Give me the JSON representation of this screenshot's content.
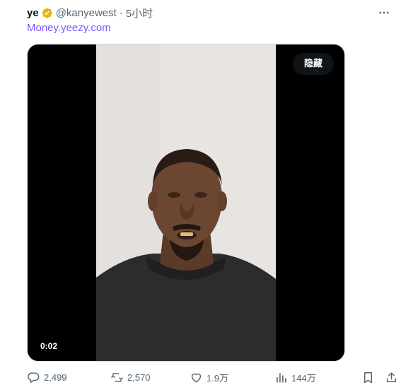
{
  "author": {
    "display_name": "ye",
    "handle": "@kanyewest",
    "separator": "·",
    "time": "5小时"
  },
  "post": {
    "link_text": "Money.yeezy.com"
  },
  "media": {
    "hide_label": "隐藏",
    "timestamp": "0:02"
  },
  "actions": {
    "reply_count": "2,499",
    "repost_count": "2,570",
    "like_count": "1.9万",
    "view_count": "144万"
  },
  "colors": {
    "link": "#7856ff",
    "verified": "#e2b719",
    "muted": "#536471"
  },
  "icons": {
    "verified": "verified-badge-icon",
    "more": "more-icon",
    "reply": "reply-icon",
    "repost": "repost-icon",
    "like": "heart-icon",
    "views": "views-icon",
    "bookmark": "bookmark-icon",
    "share": "share-icon"
  }
}
